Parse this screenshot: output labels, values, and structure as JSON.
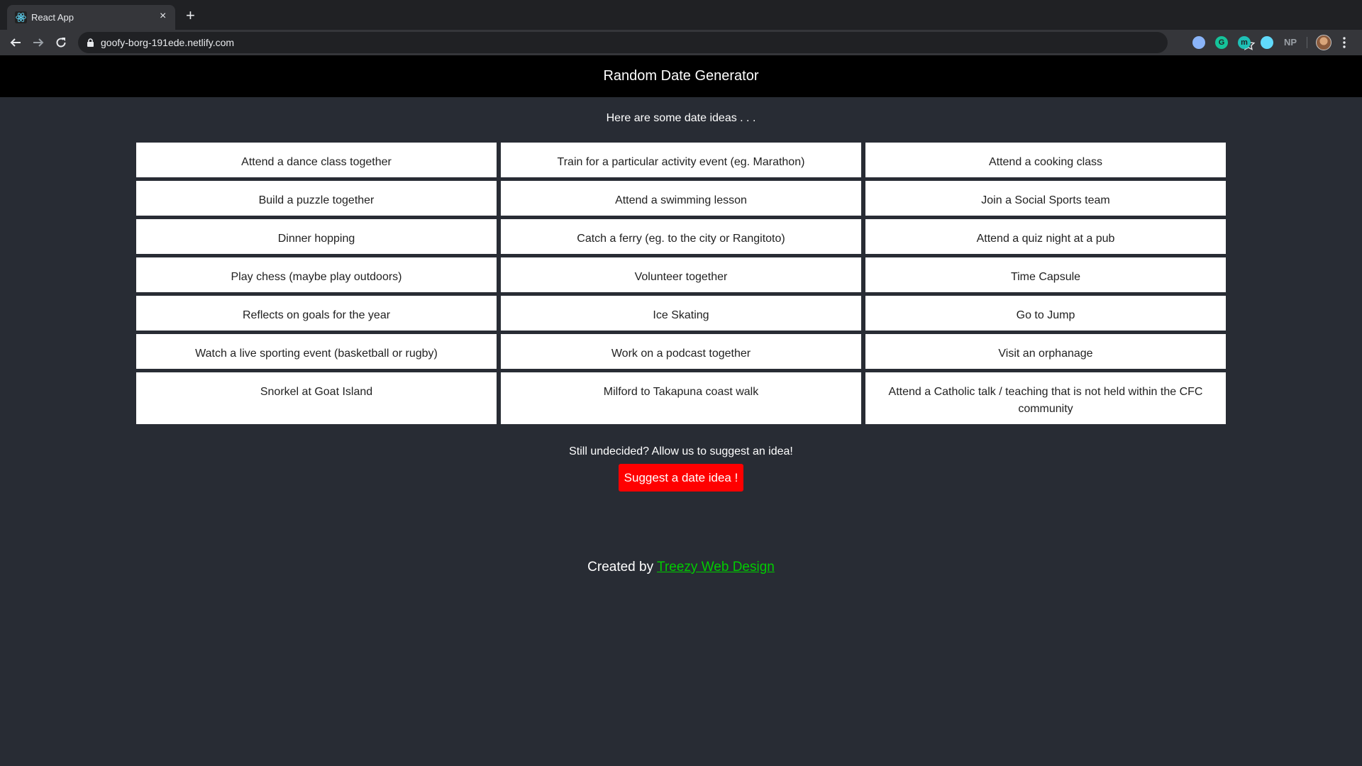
{
  "browser": {
    "tab_title": "React App",
    "tab_close": "×",
    "new_tab": "+",
    "url": "goofy-borg-191ede.netlify.com",
    "extensions": [
      {
        "name": "extension-circle-icon",
        "color": "#8ab4f8",
        "label": ""
      },
      {
        "name": "grammarly-icon",
        "color": "#15c39a",
        "label": "G"
      },
      {
        "name": "m-extension-icon",
        "color": "#1ec0b6",
        "label": "m"
      },
      {
        "name": "react-devtools-icon",
        "color": "#61dafb",
        "label": ""
      }
    ],
    "ext_np": "NP"
  },
  "header": {
    "title": "Random Date Generator"
  },
  "intro": "Here are some date ideas . . .",
  "ideas": [
    "Attend a dance class together",
    "Train for a particular activity event (eg. Marathon)",
    "Attend a cooking class",
    "Build a puzzle together",
    "Attend a swimming lesson",
    "Join a Social Sports team",
    "Dinner hopping",
    "Catch a ferry (eg. to the city or Rangitoto)",
    "Attend a quiz night at a pub",
    "Play chess (maybe play outdoors)",
    "Volunteer together",
    "Time Capsule",
    "Reflects on goals for the year",
    "Ice Skating",
    "Go to Jump",
    "Watch a live sporting event (basketball or rugby)",
    "Work on a podcast together",
    "Visit an orphanage",
    "Snorkel at Goat Island",
    "Milford to Takapuna coast walk",
    "Attend a Catholic talk / teaching that is not held within the CFC community"
  ],
  "suggest": {
    "prompt": "Still undecided? Allow us to suggest an idea!",
    "button_label": "Suggest a date idea !",
    "button_color": "#ff0000"
  },
  "footer": {
    "prefix": "Created by ",
    "link_text": "Treezy Web Design",
    "link_color": "#00cc00"
  }
}
